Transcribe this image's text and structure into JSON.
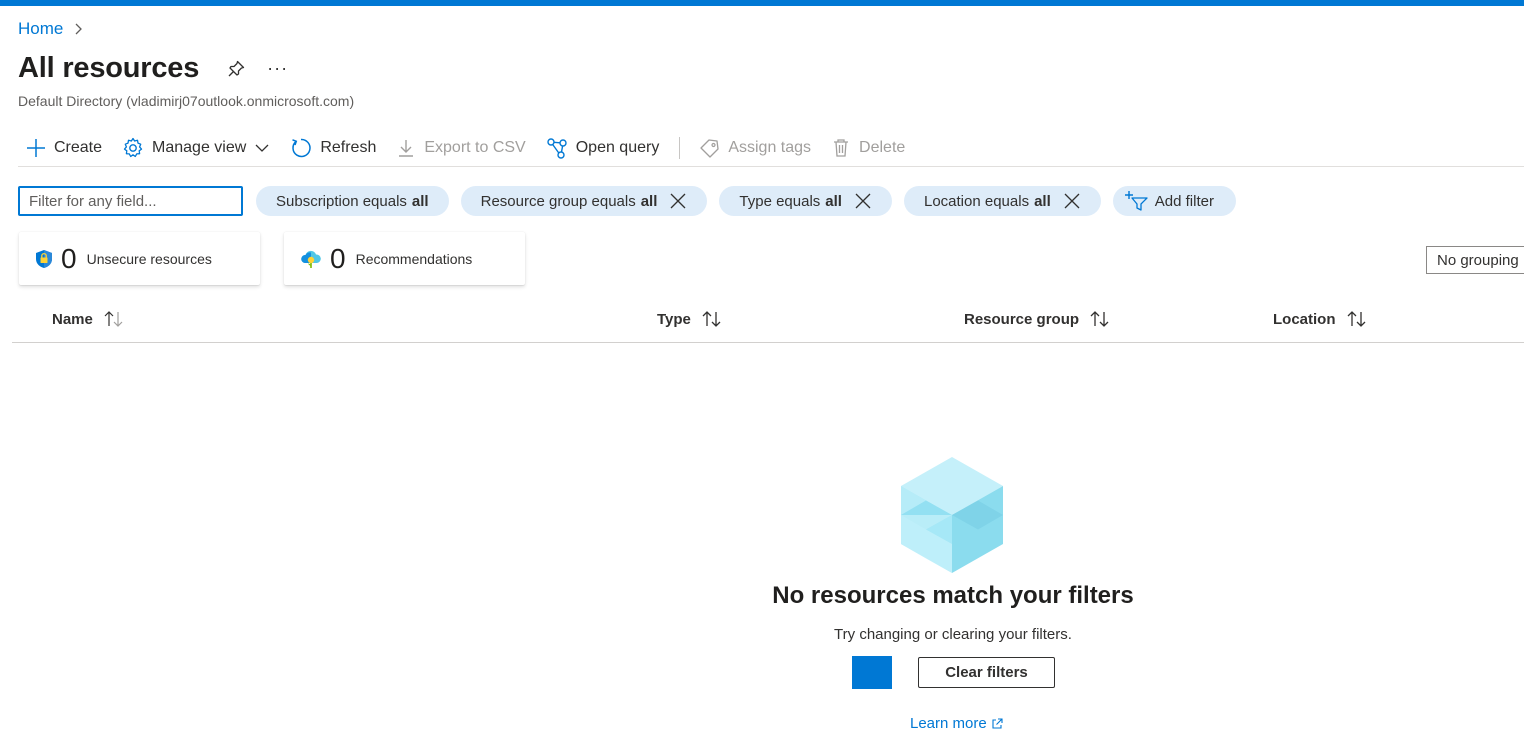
{
  "breadcrumb": {
    "home": "Home"
  },
  "page": {
    "title": "All resources",
    "subtitle": "Default Directory (vladimirj07outlook.onmicrosoft.com)",
    "more": "···"
  },
  "toolbar": {
    "create": "Create",
    "manage_view": "Manage view",
    "refresh": "Refresh",
    "export_csv": "Export to CSV",
    "open_query": "Open query",
    "assign_tags": "Assign tags",
    "delete": "Delete"
  },
  "filters": {
    "search_placeholder": "Filter for any field...",
    "pills": [
      {
        "field": "Subscription equals",
        "value": "all"
      },
      {
        "field": "Resource group equals",
        "value": "all"
      },
      {
        "field": "Type equals",
        "value": "all"
      },
      {
        "field": "Location equals",
        "value": "all"
      }
    ],
    "add_filter": "Add filter"
  },
  "cards": [
    {
      "count": "0",
      "label": "Unsecure resources",
      "icon": "shield-lock-icon"
    },
    {
      "count": "0",
      "label": "Recommendations",
      "icon": "cloud-advisor-icon"
    }
  ],
  "grouping": {
    "selected": "No grouping"
  },
  "table": {
    "columns": [
      "Name",
      "Type",
      "Resource group",
      "Location"
    ]
  },
  "empty_state": {
    "title": "No resources match your filters",
    "subtitle": "Try changing or clearing your filters.",
    "clear_button": "Clear filters",
    "learn_more": "Learn more"
  },
  "colors": {
    "accent": "#0078d4",
    "pill_bg": "#deecf9",
    "text": "#323130"
  }
}
